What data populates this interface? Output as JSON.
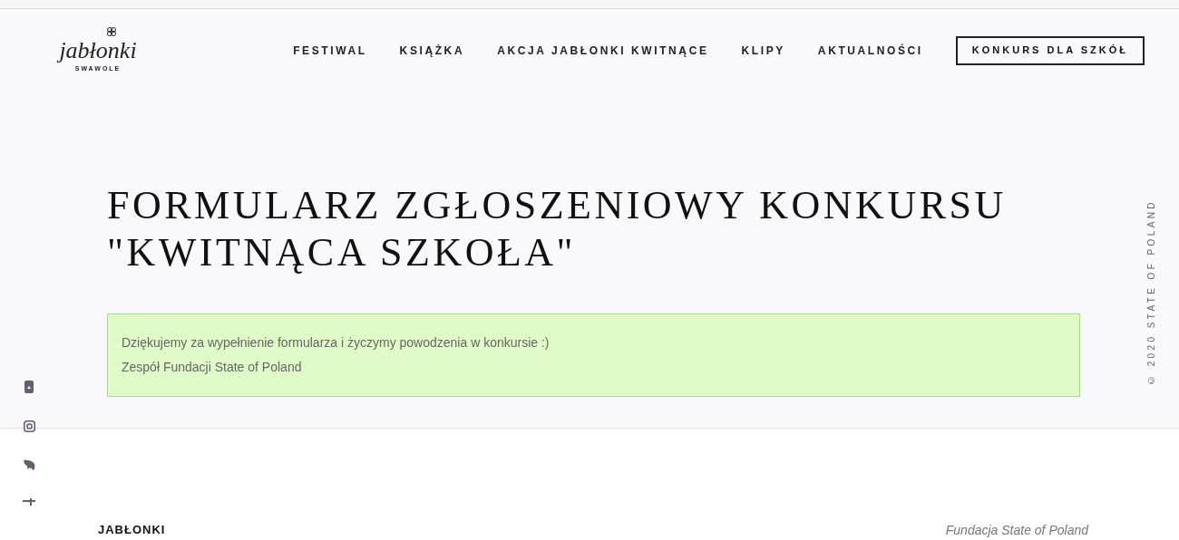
{
  "logo": {
    "script": "jabłonki",
    "tagline": "SWAWOLE"
  },
  "nav": [
    {
      "label": "FESTIWAL",
      "kind": "link"
    },
    {
      "label": "KSIĄŻKA",
      "kind": "link"
    },
    {
      "label": "AKCJA JABŁONKI KWITNĄCE",
      "kind": "link"
    },
    {
      "label": "KLIPY",
      "kind": "link"
    },
    {
      "label": "AKTUALNOŚCI",
      "kind": "link"
    },
    {
      "label": "KONKURS DLA SZKÓŁ",
      "kind": "button"
    }
  ],
  "title_lines": [
    "FORMULARZ ZGŁOSZENIOWY KONKURSU",
    "\"KWITNĄCA SZKOŁA\""
  ],
  "success_message": [
    "Dziękujemy za wypełnienie formularza i życzymy powodzenia w konkursie :)",
    "Zespół Fundacji State of Poland"
  ],
  "side_copyright": "© 2020 STATE OF POLAND",
  "footer": {
    "heading": "JABŁONKI",
    "organization": "Fundacja State of Poland"
  }
}
